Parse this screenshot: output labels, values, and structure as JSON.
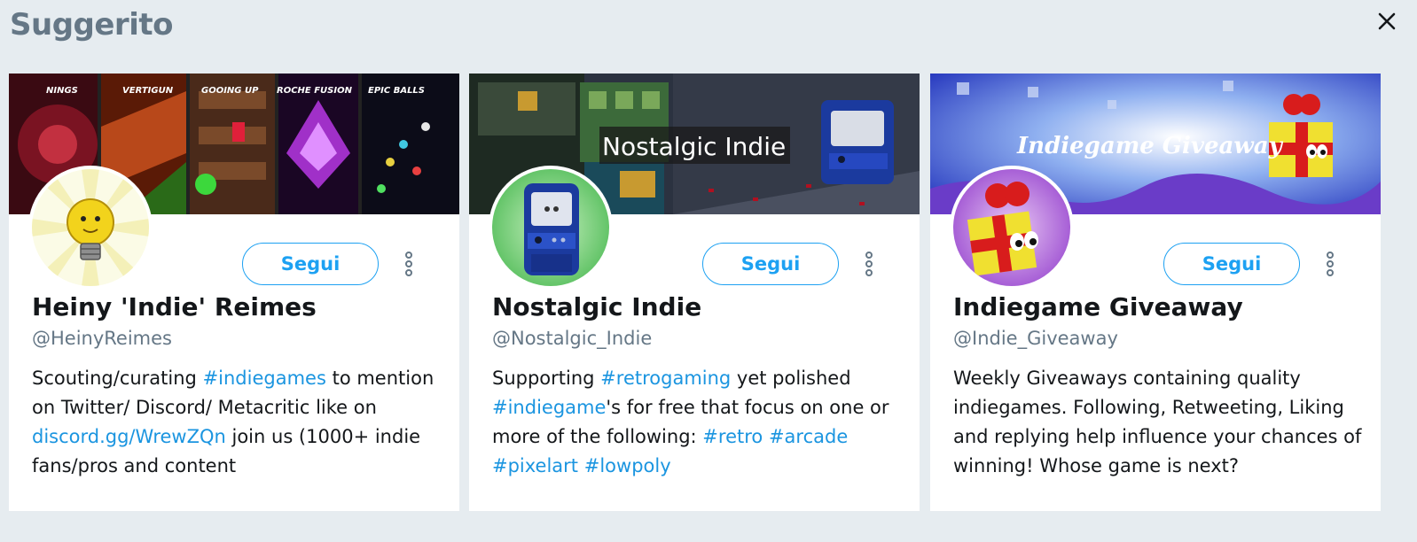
{
  "header": {
    "title": "Suggerito",
    "close_icon": "close-icon"
  },
  "colors": {
    "accent": "#1da1f2",
    "link": "#1b95e0",
    "background": "#e6ecf0"
  },
  "cards": [
    {
      "name": "Heiny 'Indie' Reimes",
      "handle": "@HeinyReimes",
      "follow_label": "Segui",
      "banner_labels": [
        "NINGS",
        "VERTIGUN",
        "GOOING UP",
        "ROCHE FUSION",
        "EPIC BALLS"
      ],
      "bio": [
        {
          "text": "Scouting/curating ",
          "link": false
        },
        {
          "text": "#indiegames",
          "link": true
        },
        {
          "text": " to mention on Twitter/ Discord/ Metacritic like on ",
          "link": false
        },
        {
          "text": "discord.gg/WrewZQn",
          "link": true
        },
        {
          "text": " join us (1000+ indie fans/pros and content",
          "link": false
        }
      ]
    },
    {
      "name": "Nostalgic Indie",
      "handle": "@Nostalgic_Indie",
      "follow_label": "Segui",
      "banner_labels": [
        "Nostalgic Indie"
      ],
      "bio": [
        {
          "text": "Supporting ",
          "link": false
        },
        {
          "text": "#retrogaming",
          "link": true
        },
        {
          "text": " yet polished ",
          "link": false
        },
        {
          "text": "#indiegame",
          "link": true
        },
        {
          "text": "'s for free that focus on one or more of the following: ",
          "link": false
        },
        {
          "text": "#retro",
          "link": true
        },
        {
          "text": " ",
          "link": false
        },
        {
          "text": "#arcade",
          "link": true
        },
        {
          "text": " ",
          "link": false
        },
        {
          "text": "#pixelart",
          "link": true
        },
        {
          "text": " ",
          "link": false
        },
        {
          "text": "#lowpoly",
          "link": true
        }
      ]
    },
    {
      "name": "Indiegame Giveaway",
      "handle": "@Indie_Giveaway",
      "follow_label": "Segui",
      "banner_labels": [
        "Indiegame Giveaway"
      ],
      "bio": [
        {
          "text": "Weekly Giveaways containing quality indiegames. Following, Retweeting, Liking and replying help influence your chances of winning! Whose game is next?",
          "link": false
        }
      ]
    }
  ]
}
